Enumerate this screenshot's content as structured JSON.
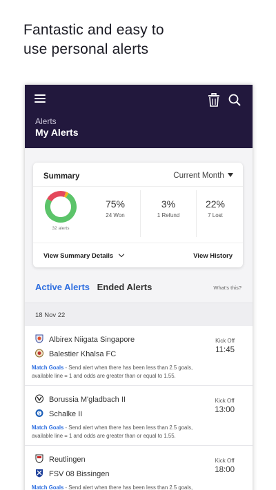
{
  "promo": {
    "headline_line1": "Fantastic and easy to",
    "headline_line2": "use personal alerts"
  },
  "appbar": {
    "breadcrumb": "Alerts",
    "title": "My Alerts",
    "background": "#22183d"
  },
  "summary": {
    "heading": "Summary",
    "period": "Current Month",
    "alerts_count_label": "32 alerts",
    "donut": {
      "won_fraction": 0.75,
      "refund_fraction": 0.03,
      "lost_fraction": 0.22,
      "colors": {
        "won": "#5cc46a",
        "refund": "#f2b01e",
        "lost": "#e4485b"
      }
    },
    "stats": [
      {
        "pct": "75%",
        "label": "24 Won"
      },
      {
        "pct": "3%",
        "label": "1 Refund"
      },
      {
        "pct": "22%",
        "label": "7 Lost"
      }
    ],
    "details_label": "View Summary Details",
    "history_label": "View History"
  },
  "tabs": {
    "active": "Active Alerts",
    "ended": "Ended Alerts",
    "whats_this": "What's this?"
  },
  "date_header": "18 Nov 22",
  "matches": [
    {
      "home": "Albirex Niigata Singapore",
      "away": "Balestier Khalsa FC",
      "kickoff_label": "Kick Off",
      "time": "11:45",
      "alert_type": "Match Goals",
      "alert_text_line1": " - Send alert when there has been less than 2.5 goals,",
      "alert_text_line2": "available line = 1 and odds are greater than or equal to 1.55."
    },
    {
      "home": "Borussia M'gladbach II",
      "away": "Schalke II",
      "kickoff_label": "Kick Off",
      "time": "13:00",
      "alert_type": "Match Goals",
      "alert_text_line1": " - Send alert when there has been less than 2.5 goals,",
      "alert_text_line2": "available line = 1 and odds are greater than or equal to 1.55."
    },
    {
      "home": "Reutlingen",
      "away": "FSV 08 Bissingen",
      "kickoff_label": "Kick Off",
      "time": "18:00",
      "alert_type": "Match Goals",
      "alert_text_line1": " - Send alert when there has been less than 2.5 goals,",
      "alert_text_line2": ""
    }
  ],
  "icons": {
    "menu": "hamburger-menu-icon",
    "trash": "trash-icon",
    "search": "search-icon"
  },
  "accent_color": "#2f6fe0"
}
